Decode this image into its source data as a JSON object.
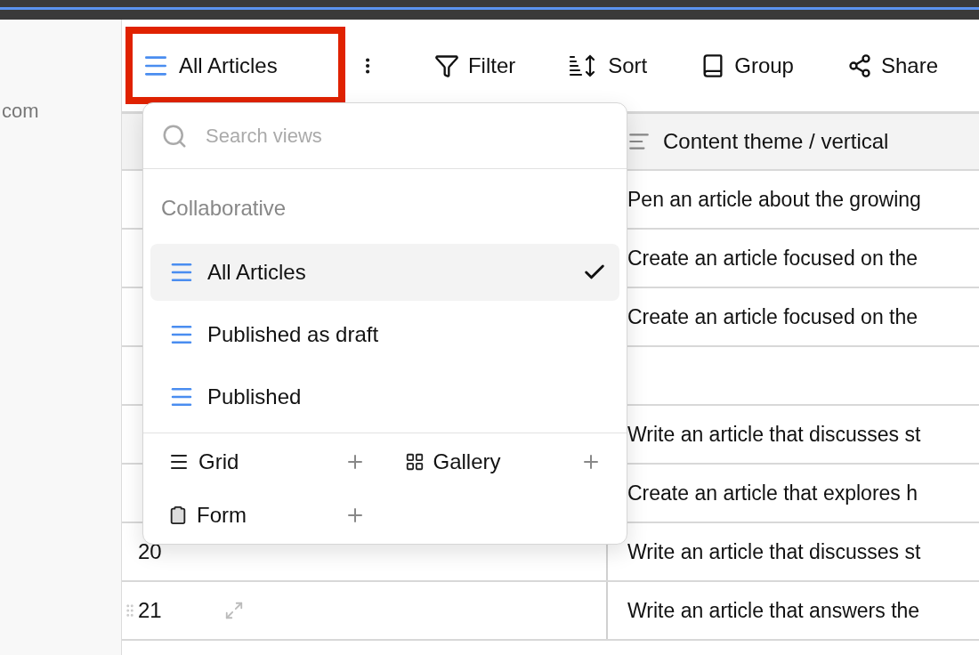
{
  "sidebar": {
    "text": "com"
  },
  "toolbar": {
    "view_button": {
      "label": "All Articles",
      "highlighted": true
    },
    "actions": [
      {
        "kind": "filter",
        "label": "Filter"
      },
      {
        "kind": "sort",
        "label": "Sort"
      },
      {
        "kind": "group",
        "label": "Group"
      },
      {
        "kind": "share",
        "label": "Share"
      }
    ]
  },
  "table": {
    "columns": [
      {
        "label": "Content theme / vertical"
      }
    ],
    "rows": [
      {
        "content": "Pen an article about the growing"
      },
      {
        "content": "Create an article focused on the"
      },
      {
        "content": "Create an article focused on the"
      },
      {
        "content": ""
      },
      {
        "content": "Write an article that discusses st"
      },
      {
        "content": "Create an article that explores h"
      },
      {
        "number": "20",
        "content": "Write an article that discusses st",
        "hovered": false
      },
      {
        "number": "21",
        "content": "Write an article that answers the",
        "hovered": true
      }
    ]
  },
  "view_menu": {
    "search": {
      "placeholder": "Search views"
    },
    "section": "Collaborative",
    "views": [
      {
        "label": "All Articles",
        "selected": true
      },
      {
        "label": "Published as draft",
        "selected": false
      },
      {
        "label": "Published",
        "selected": false
      }
    ],
    "create": [
      {
        "kind": "grid",
        "label": "Grid"
      },
      {
        "kind": "gallery",
        "label": "Gallery"
      },
      {
        "kind": "form",
        "label": "Form"
      }
    ]
  }
}
